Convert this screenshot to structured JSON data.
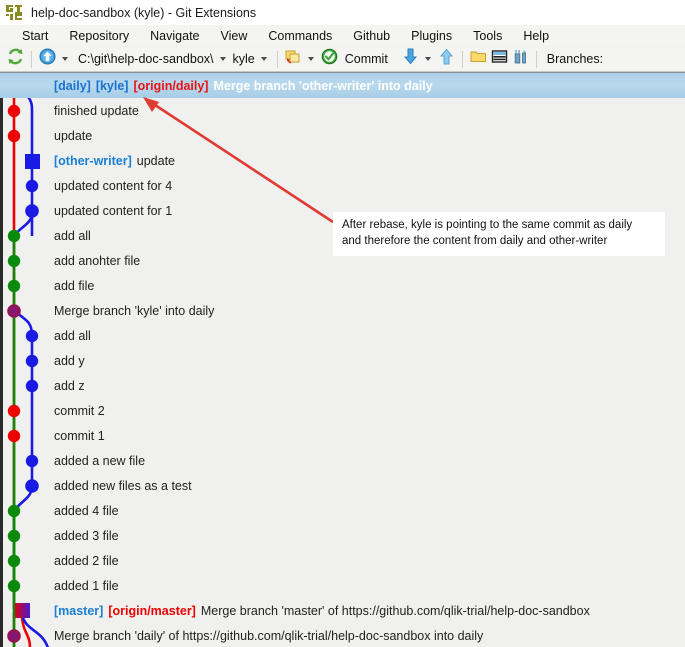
{
  "window": {
    "title": "help-doc-sandbox (kyle) - Git Extensions",
    "icon": "git-extensions-logo"
  },
  "menubar": {
    "items": [
      {
        "label": "Start"
      },
      {
        "label": "Repository"
      },
      {
        "label": "Navigate"
      },
      {
        "label": "View"
      },
      {
        "label": "Commands"
      },
      {
        "label": "Github"
      },
      {
        "label": "Plugins"
      },
      {
        "label": "Tools"
      },
      {
        "label": "Help"
      }
    ]
  },
  "toolbar": {
    "refresh_icon": "refresh-icon",
    "pull_icon": "pull-arrow-up-icon",
    "path_value": "C:\\git\\help-doc-sandbox\\",
    "branch_value": "kyle",
    "stash_icon": "stash-changes-icon",
    "commit_icon": "commit-check-icon",
    "commit_label": "Commit",
    "pull_down_icon": "pull-down-arrow-icon",
    "push_up_icon": "push-up-arrow-icon",
    "browse_icon": "open-folder-icon",
    "filelist_icon": "file-explorer-icon",
    "settings_icon": "settings-tools-icon",
    "branches_label": "Branches:"
  },
  "commits": {
    "rows": [
      {
        "refs": [],
        "message": "Merge branch 'other-writer' into daily",
        "selected": true,
        "refs_list": [
          {
            "text": "[daily]",
            "type": "local"
          },
          {
            "text": "[kyle]",
            "type": "local"
          },
          {
            "text": "[origin/daily]",
            "type": "remote"
          }
        ]
      },
      {
        "message": "finished update",
        "refs_list": []
      },
      {
        "message": "update",
        "refs_list": []
      },
      {
        "message": "update",
        "refs_list": [
          {
            "text": "[other-writer]",
            "type": "local"
          }
        ]
      },
      {
        "message": "updated content for 4",
        "refs_list": []
      },
      {
        "message": "updated content for 1",
        "refs_list": []
      },
      {
        "message": "add all",
        "refs_list": []
      },
      {
        "message": "add anohter file",
        "refs_list": []
      },
      {
        "message": "add file",
        "refs_list": []
      },
      {
        "message": "Merge branch 'kyle' into daily",
        "refs_list": []
      },
      {
        "message": "add all",
        "refs_list": []
      },
      {
        "message": "add y",
        "refs_list": []
      },
      {
        "message": "add z",
        "refs_list": []
      },
      {
        "message": "commit 2",
        "refs_list": []
      },
      {
        "message": "commit 1",
        "refs_list": []
      },
      {
        "message": "added a new file",
        "refs_list": []
      },
      {
        "message": "added new files as a test",
        "refs_list": []
      },
      {
        "message": "added 4 file",
        "refs_list": []
      },
      {
        "message": "added 3 file",
        "refs_list": []
      },
      {
        "message": "added 2 file",
        "refs_list": []
      },
      {
        "message": "added 1 file",
        "refs_list": []
      },
      {
        "message": "Merge branch 'master' of https://github.com/qlik-trial/help-doc-sandbox",
        "refs_list": [
          {
            "text": "[master]",
            "type": "local"
          },
          {
            "text": "[origin/master]",
            "type": "remote"
          }
        ]
      },
      {
        "message": "Merge branch 'daily' of https://github.com/qlik-trial/help-doc-sandbox into daily",
        "refs_list": []
      }
    ]
  },
  "annotation": {
    "line1": "After rebase, kyle is pointing to the same commit as daily",
    "line2": "and therefore the content from daily and other-writer",
    "arrow_color": "#e03a32"
  },
  "colors": {
    "red": "#ee0000",
    "blue": "#1a1ae6",
    "green": "#0a8a0a",
    "selection_blue": "#b0d4ea",
    "panel_bg": "#f0f0ee",
    "toolbar_bg": "#f4f4f2",
    "local_ref": "#1a7fd4",
    "remote_ref": "#ee0000"
  }
}
